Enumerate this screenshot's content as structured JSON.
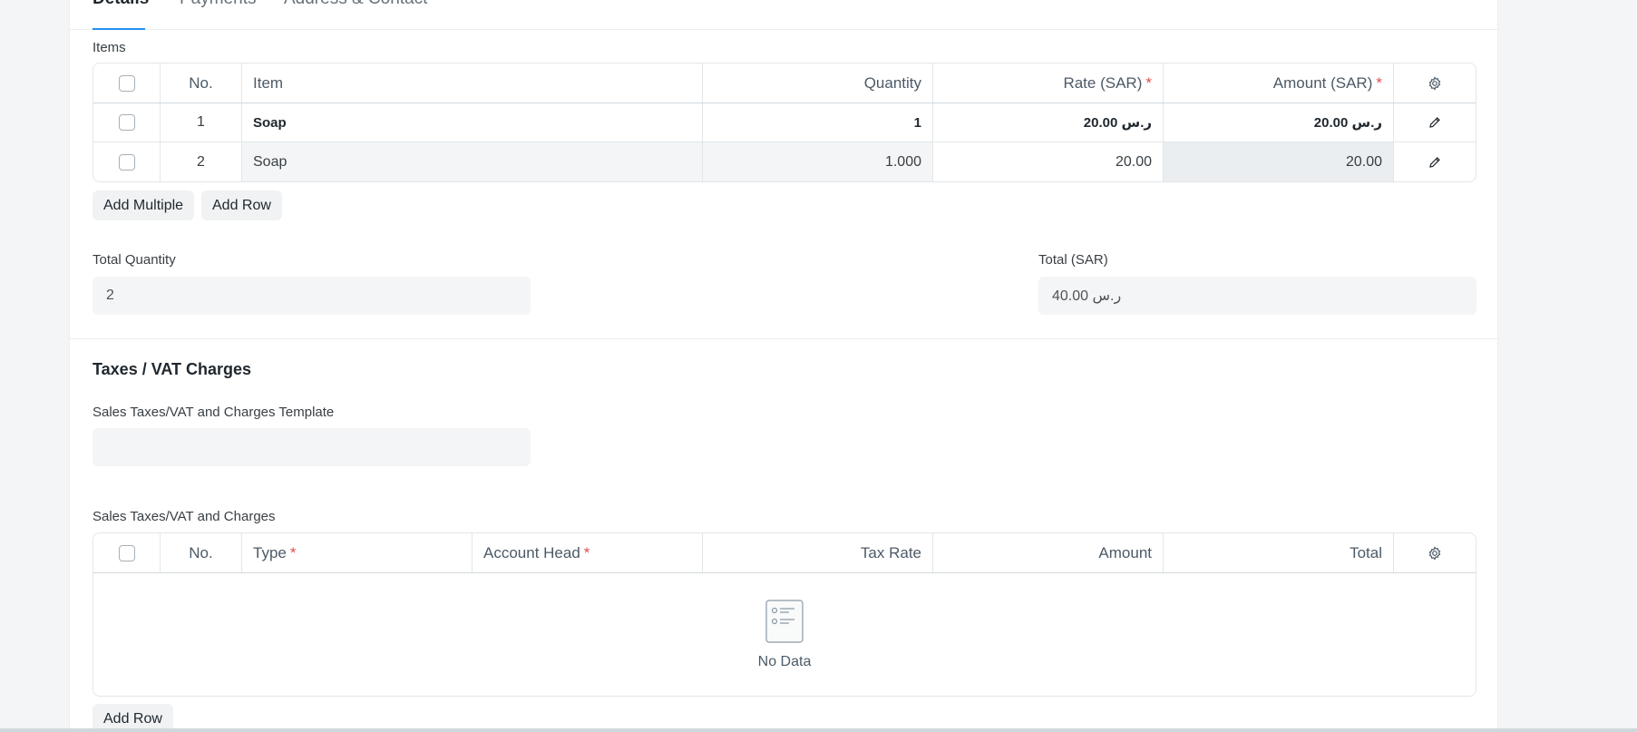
{
  "tabs": [
    {
      "label": "Details",
      "active": true
    },
    {
      "label": "Payments",
      "active": false
    },
    {
      "label": "Address & Contact",
      "active": false
    }
  ],
  "items_section": {
    "label": "Items",
    "columns": {
      "no": "No.",
      "item": "Item",
      "quantity": "Quantity",
      "rate": "Rate (SAR)",
      "amount": "Amount (SAR)",
      "required_mark": "*"
    },
    "rows": [
      {
        "no": "1",
        "item": "Soap",
        "quantity": "1",
        "rate": "ر.س 20.00",
        "amount": "ر.س 20.00"
      },
      {
        "no": "2",
        "item": "Soap",
        "quantity": "1.000",
        "rate": "20.00",
        "amount": "20.00"
      }
    ],
    "add_multiple_label": "Add Multiple",
    "add_row_label": "Add Row"
  },
  "totals": {
    "total_quantity_label": "Total Quantity",
    "total_quantity_value": "2",
    "total_label": "Total (SAR)",
    "total_value": "ر.س 40.00"
  },
  "taxes_section": {
    "title": "Taxes / VAT Charges",
    "template_label": "Sales Taxes/VAT and Charges Template",
    "template_value": "",
    "charges_label": "Sales Taxes/VAT and Charges",
    "columns": {
      "no": "No.",
      "type": "Type",
      "account_head": "Account Head",
      "tax_rate": "Tax Rate",
      "amount": "Amount",
      "total": "Total",
      "required_mark": "*"
    },
    "empty_text": "No Data",
    "add_row_label": "Add Row"
  },
  "colors": {
    "accent": "#2490ef",
    "required": "#e24c4c"
  }
}
